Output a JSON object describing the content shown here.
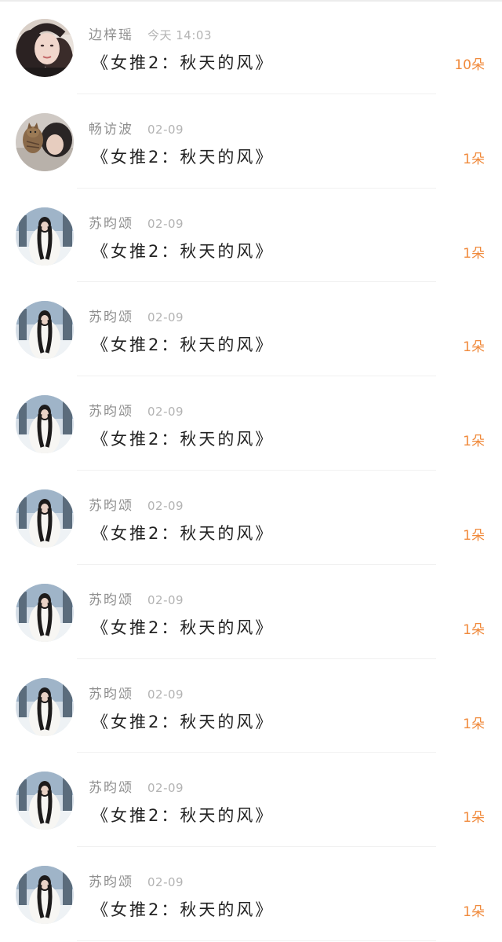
{
  "colors": {
    "background": "#ffffff",
    "name_text": "#8f8f8f",
    "time_text": "#b3b3b3",
    "body_text": "#222222",
    "count_accent": "#f08a3c",
    "divider": "#f1f1f1"
  },
  "gift_records": [
    {
      "user": "边梓瑶",
      "time": "今天 14:03",
      "book": "《女推2：秋天的风》",
      "count": "10朵",
      "avatar": "woman-portrait"
    },
    {
      "user": "畅访波",
      "time": "02-09",
      "book": "《女推2：秋天的风》",
      "count": "1朵",
      "avatar": "person-with-cat"
    },
    {
      "user": "苏昀颂",
      "time": "02-09",
      "book": "《女推2：秋天的风》",
      "count": "1朵",
      "avatar": "woman-white-coat-snow"
    },
    {
      "user": "苏昀颂",
      "time": "02-09",
      "book": "《女推2：秋天的风》",
      "count": "1朵",
      "avatar": "woman-white-coat-snow"
    },
    {
      "user": "苏昀颂",
      "time": "02-09",
      "book": "《女推2：秋天的风》",
      "count": "1朵",
      "avatar": "woman-white-coat-snow"
    },
    {
      "user": "苏昀颂",
      "time": "02-09",
      "book": "《女推2：秋天的风》",
      "count": "1朵",
      "avatar": "woman-white-coat-snow"
    },
    {
      "user": "苏昀颂",
      "time": "02-09",
      "book": "《女推2：秋天的风》",
      "count": "1朵",
      "avatar": "woman-white-coat-snow"
    },
    {
      "user": "苏昀颂",
      "time": "02-09",
      "book": "《女推2：秋天的风》",
      "count": "1朵",
      "avatar": "woman-white-coat-snow"
    },
    {
      "user": "苏昀颂",
      "time": "02-09",
      "book": "《女推2：秋天的风》",
      "count": "1朵",
      "avatar": "woman-white-coat-snow"
    },
    {
      "user": "苏昀颂",
      "time": "02-09",
      "book": "《女推2：秋天的风》",
      "count": "1朵",
      "avatar": "woman-white-coat-snow"
    }
  ]
}
